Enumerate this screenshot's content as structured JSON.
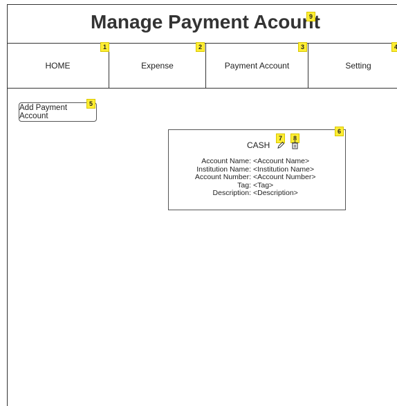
{
  "header": {
    "title": "Manage Payment Acount",
    "title_badge": "9"
  },
  "nav": {
    "tabs": [
      {
        "label": "HOME",
        "badge": "1"
      },
      {
        "label": "Expense",
        "badge": "2"
      },
      {
        "label": "Payment Account",
        "badge": "3"
      },
      {
        "label": "Setting",
        "badge": "4"
      }
    ]
  },
  "toolbar": {
    "add_label": "Add Payment Account",
    "add_badge": "5"
  },
  "account_card": {
    "badge": "6",
    "title": "CASH",
    "edit_badge": "7",
    "delete_badge": "8",
    "fields": [
      {
        "label": "Account Name:",
        "value": "<Account Name>"
      },
      {
        "label": "Institution Name:",
        "value": "<Institution Name>"
      },
      {
        "label": "Account Number:",
        "value": "<Account Number>"
      },
      {
        "label": "Tag:",
        "value": "<Tag>"
      },
      {
        "label": "Description:",
        "value": "<Description>"
      }
    ]
  },
  "colors": {
    "badge": "#ffee33",
    "border": "#333333"
  },
  "icons": {
    "edit": "pencil-icon",
    "delete": "trash-icon"
  }
}
